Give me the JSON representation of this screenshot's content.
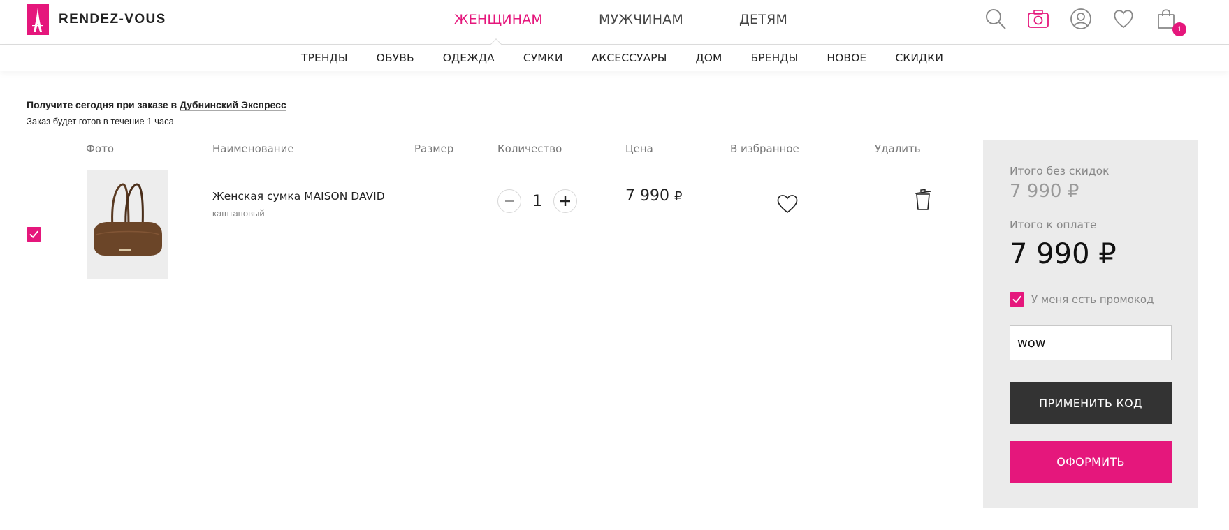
{
  "brand": {
    "name": "RENDEZ-VOUS",
    "color": "#e5177c"
  },
  "main_nav": [
    {
      "label": "ЖЕНЩИНАМ",
      "active": true
    },
    {
      "label": "МУЖЧИНАМ",
      "active": false
    },
    {
      "label": "ДЕТЯМ",
      "active": false
    }
  ],
  "header_icons": [
    "search-icon",
    "camera-icon",
    "user-icon",
    "heart-icon",
    "cart-icon"
  ],
  "cart": {
    "count": "1"
  },
  "sub_nav": [
    "ТРЕНДЫ",
    "ОБУВЬ",
    "ОДЕЖДА",
    "СУМКИ",
    "АКСЕССУАРЫ",
    "ДОМ",
    "БРЕНДЫ",
    "НОВОЕ",
    "СКИДКИ"
  ],
  "notice": {
    "title_prefix": "Получите сегодня при заказе в ",
    "title_link": "Дубнинский Экспресс",
    "subtitle": "Заказ будет готов в течение 1 часа"
  },
  "table": {
    "headers": {
      "photo": "Фото",
      "name": "Наименование",
      "size": "Размер",
      "qty": "Количество",
      "price": "Цена",
      "fav": "В избранное",
      "del": "Удалить"
    },
    "rows": [
      {
        "checked": true,
        "name": "Женская сумка MAISON DAVID",
        "color": "каштановый",
        "size": "",
        "qty": "1",
        "price": "7 990",
        "currency": "₽"
      }
    ]
  },
  "summary": {
    "subtotal_label": "Итого без скидок",
    "subtotal": "7 990 ₽",
    "total_label": "Итого к оплате",
    "total": "7 990 ₽",
    "promo_label": "У меня есть промокод",
    "promo_value": "wow",
    "apply_label": "ПРИМЕНИТЬ КОД",
    "checkout_label": "ОФОРМИТЬ"
  }
}
